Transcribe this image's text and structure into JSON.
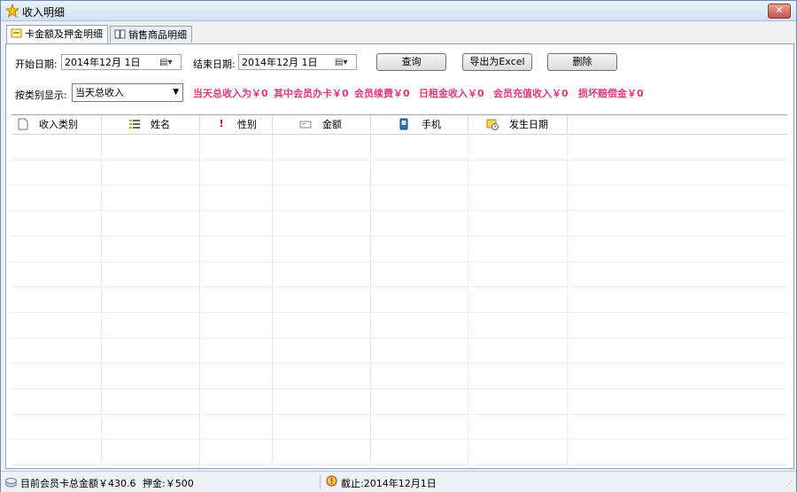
{
  "window": {
    "title": "收入明细",
    "close_label": "✕"
  },
  "tabs": [
    {
      "label": "卡金额及押金明细",
      "active": true
    },
    {
      "label": "销售商品明细",
      "active": false
    }
  ],
  "filters": {
    "start_label": "开始日期:",
    "start_value": "2014年12月 1日",
    "end_label": "结束日期:",
    "end_value": "2014年12月 1日",
    "query_button": "查询",
    "export_button": "导出为Excel",
    "delete_button": "删除",
    "category_label": "按类别显示:",
    "category_value": "当天总收入"
  },
  "summary": {
    "total": "当天总收入为￥0",
    "card_issue": "其中会员办卡￥0",
    "renewal": "会员续费￥0",
    "daily_rent": "日租金收入￥0",
    "recharge": "会员充值收入￥0",
    "damage": "损坏赔偿金￥0"
  },
  "table": {
    "columns": [
      {
        "label": "收入类别",
        "icon": "document-icon"
      },
      {
        "label": "姓名",
        "icon": "list-icon"
      },
      {
        "label": "性别",
        "icon": "exclamation-icon"
      },
      {
        "label": "金额",
        "icon": "money-icon"
      },
      {
        "label": "手机",
        "icon": "phone-icon"
      },
      {
        "label": "发生日期",
        "icon": "calendar-clock-icon"
      }
    ],
    "rows": []
  },
  "statusbar": {
    "card_total": "目前会员卡总金额￥430.6",
    "deposit": "押金:￥500",
    "as_of": "截止:2014年12月1日"
  },
  "colors": {
    "summary_text": "#e2387a",
    "titlebar": "#d3e2f3"
  }
}
